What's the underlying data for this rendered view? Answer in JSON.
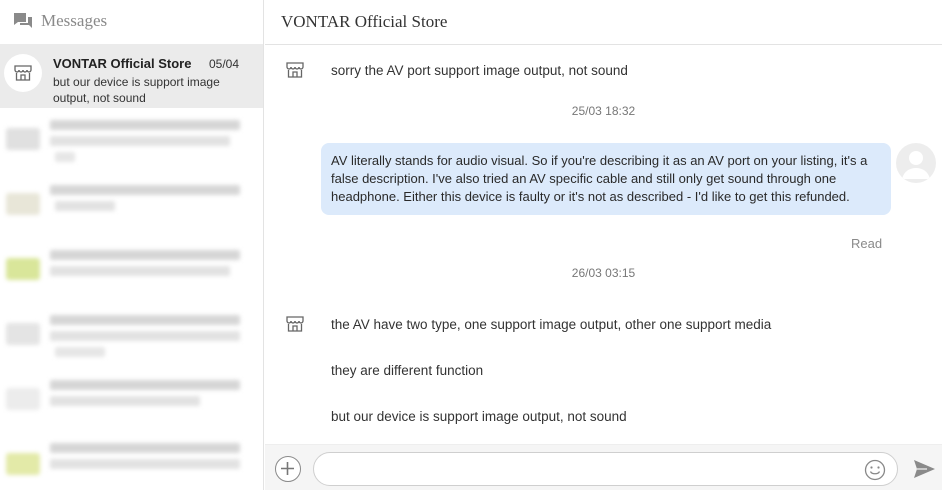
{
  "sidebar": {
    "title": "Messages",
    "active_conversation": {
      "name": "VONTAR Official Store",
      "date": "05/04",
      "preview": "but our device is support image output, not sound"
    }
  },
  "chat": {
    "title": "VONTAR Official Store",
    "messages": [
      {
        "text": "sorry the AV port support image output, not sound"
      },
      {
        "text": "AV literally stands for audio visual. So if you're describing it as  an AV port on your listing, it's a false description. I've also tried an AV specific cable and still only get sound through one headphone. Either this device is faulty or it's not as described - I'd like to get this refunded.",
        "status": "Read"
      },
      {
        "text": "the AV have two type, one support image output, other one support media"
      },
      {
        "text": "they are different function"
      },
      {
        "text": "but our device is support image output, not sound"
      }
    ],
    "timestamps": [
      "25/03 18:32",
      "26/03 03:15"
    ]
  },
  "composer": {
    "value": "",
    "placeholder": ""
  },
  "colors": {
    "bubble": "#dceafb",
    "active_row": "#ebebeb",
    "composer_bg": "#f5f5f5"
  }
}
